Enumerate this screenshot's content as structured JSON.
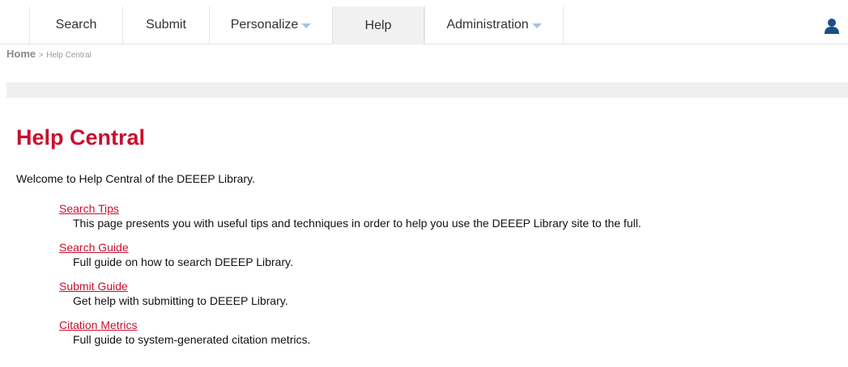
{
  "nav": {
    "tabs": [
      {
        "label": "Search",
        "dropdown": false,
        "active": false
      },
      {
        "label": "Submit",
        "dropdown": false,
        "active": false
      },
      {
        "label": "Personalize",
        "dropdown": true,
        "active": false
      },
      {
        "label": "Help",
        "dropdown": false,
        "active": true
      },
      {
        "label": "Administration",
        "dropdown": true,
        "active": false
      }
    ],
    "user_icon": "user-icon"
  },
  "breadcrumb": {
    "home": "Home",
    "separator": ">",
    "current": "Help Central"
  },
  "main": {
    "title": "Help Central",
    "intro": "Welcome to Help Central of the DEEEP Library.",
    "items": [
      {
        "label": "Search Tips",
        "description": "This page presents you with useful tips and techniques in order to help you use the DEEEP Library site to the full."
      },
      {
        "label": "Search Guide",
        "description": "Full guide on how to search DEEEP Library."
      },
      {
        "label": "Submit Guide",
        "description": "Get help with submitting to DEEEP Library."
      },
      {
        "label": "Citation Metrics",
        "description": "Full guide to system-generated citation metrics."
      }
    ]
  },
  "colors": {
    "accent": "#c8102e",
    "caret": "#9ec6e6",
    "user_icon": "#1b4f8a",
    "strip": "#efefef"
  }
}
